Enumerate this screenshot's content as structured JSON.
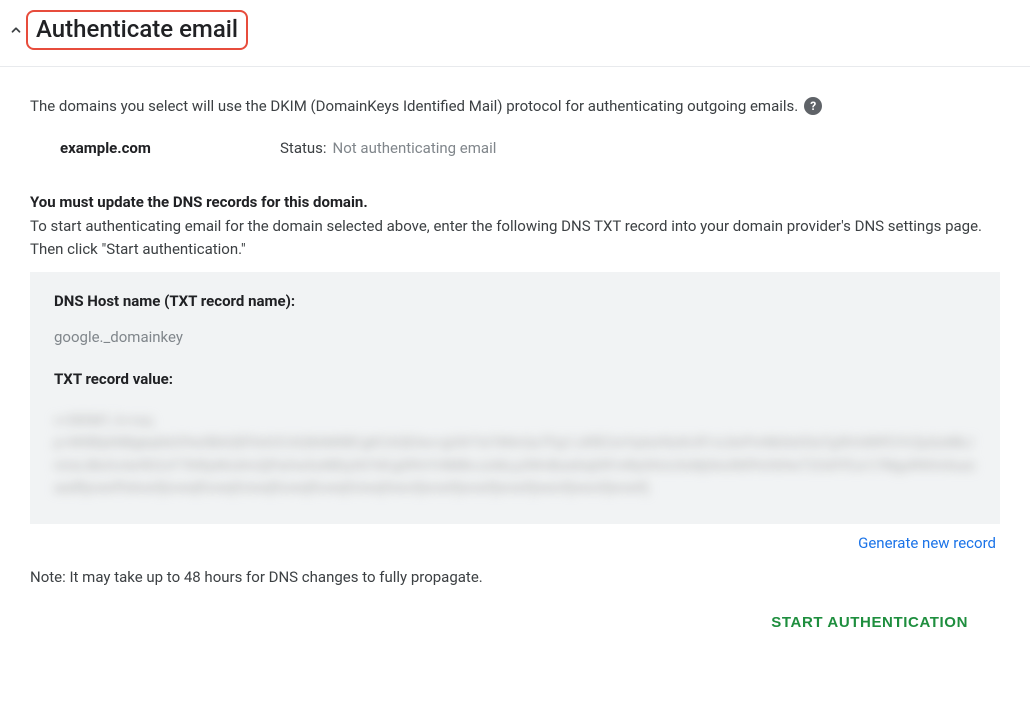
{
  "header": {
    "title": "Authenticate email"
  },
  "description": "The domains you select will use the DKIM (DomainKeys Identified Mail) protocol for authenticating outgoing emails.",
  "domain": {
    "name": "example.com",
    "status_label": "Status:",
    "status_value": "Not authenticating email"
  },
  "instructions": {
    "title": "You must update the DNS records for this domain.",
    "body": "To start authenticating email for the domain selected above, enter the following DNS TXT record into your domain provider's DNS settings page. Then click \"Start authentication.\""
  },
  "record": {
    "host_label": "DNS Host name (TXT record name):",
    "host_value": "google._domainkey",
    "txt_label": "TXT record value:",
    "txt_value_obscured": "v=DKIM1; k=rsa; p=MIIBIjANBgkqhkiG9w0BAQEFAAOCAQ8AMIIBCgKCAQEAw+gU0rTxt7kNvQa7Fpj1Jd9E2wYq4uH6zKcR1vL8oPmNbXeS3aTg5hVdWfCiYrZpQoMkJnUsLtBxGvAe9D2cF7IhRy6Ks0mZjPaOwXuNlEqVbTdCgSfHrYi4M8nJzAkLp3WvBoe6IqDtFmRyGhUcXsNj5Az0KlPeVb9wT2OdYfCa1i7MgsR4HnXuezaadfijoweffokwefjiowejfiowejfoiwejfiowejfiowejfoiwejfweofjwoeifjwoeifjwoeifjweoifjweoifjwoeifj"
  },
  "links": {
    "generate": "Generate new record"
  },
  "note": "Note: It may take up to 48 hours for DNS changes to fully propagate.",
  "actions": {
    "start": "START AUTHENTICATION"
  }
}
